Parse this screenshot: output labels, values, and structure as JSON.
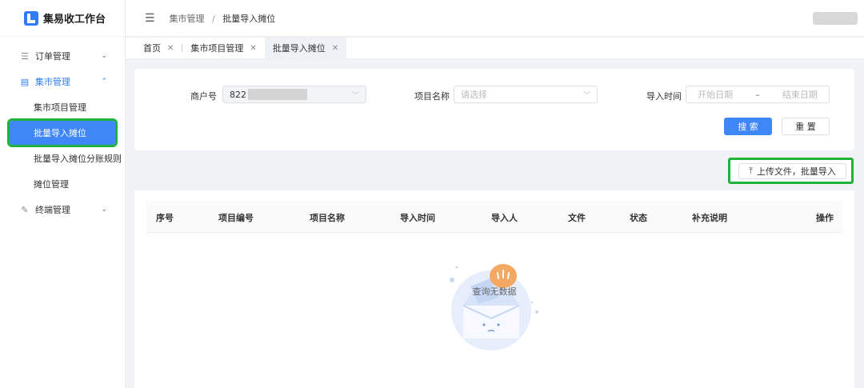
{
  "app": {
    "title": "集易收工作台"
  },
  "sidebar": {
    "groups": [
      {
        "label": "订单管理",
        "icon": "list-icon",
        "arrow": "⌄"
      },
      {
        "label": "集市管理",
        "icon": "store-icon",
        "arrow": "⌃"
      },
      {
        "label": "终端管理",
        "icon": "wrench-icon",
        "arrow": "⌄"
      }
    ],
    "subitems": [
      "集市项目管理",
      "批量导入摊位",
      "批量导入摊位分账规则",
      "摊位管理"
    ]
  },
  "header": {
    "breadcrumb": [
      "集市管理",
      "批量导入摊位"
    ],
    "separator": "/"
  },
  "tabs": [
    {
      "label": "首页"
    },
    {
      "label": "集市项目管理"
    },
    {
      "label": "批量导入摊位"
    }
  ],
  "filters": {
    "merchant_label": "商户号",
    "merchant_value": "822",
    "project_label": "项目名称",
    "project_placeholder": "请选择",
    "time_label": "导入时间",
    "start_placeholder": "开始日期",
    "range_sep": "–",
    "end_placeholder": "结束日期",
    "search_btn": "搜 索",
    "reset_btn": "重 置"
  },
  "upload": {
    "label": "上传文件，批量导入"
  },
  "table": {
    "columns": [
      "序号",
      "项目编号",
      "项目名称",
      "导入时间",
      "导入人",
      "文件",
      "状态",
      "补充说明",
      "操作"
    ],
    "empty_text": "查询无数据"
  },
  "colors": {
    "primary": "#3f86f7",
    "highlight": "#1fb33b"
  }
}
